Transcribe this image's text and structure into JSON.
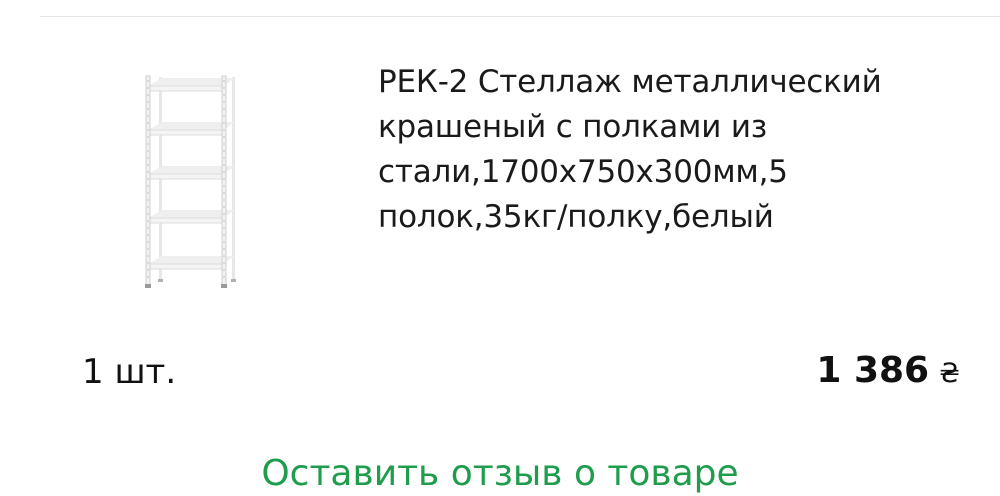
{
  "product": {
    "title": "РЕК-2 Стеллаж металлический крашеный с полками из стали,1700х750х300мм,5 полок,35кг/полку,белый",
    "image_icon": "metal-shelving-rack",
    "shelf_count": 5
  },
  "order": {
    "quantity": "1 шт.",
    "price": "1 386",
    "currency": "₴"
  },
  "actions": {
    "review_label": "Оставить отзыв о товаре"
  },
  "colors": {
    "accent": "#1f9d4d",
    "text": "#111111",
    "divider": "#e6e6e6"
  }
}
